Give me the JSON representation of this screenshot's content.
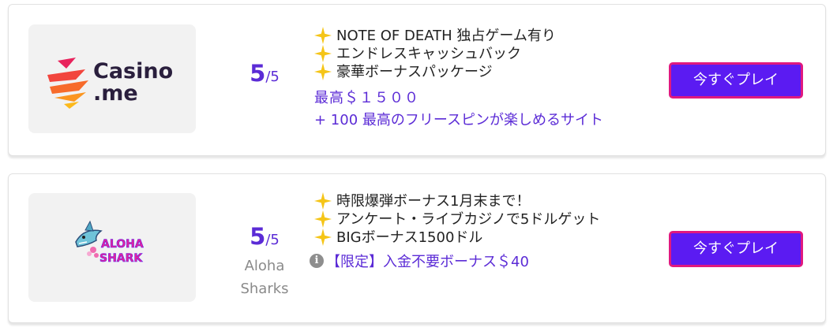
{
  "offers": [
    {
      "logo": {
        "text_line1": "Casino",
        "text_line2": ".me"
      },
      "rating": {
        "score": "5",
        "outof": "/5",
        "brand": ""
      },
      "features": [
        "NOTE OF DEATH 独占ゲーム有り",
        "エンドレスキャッシュバック",
        "豪華ボーナスパッケージ"
      ],
      "bonus_lines": [
        "最高＄１５００",
        "+ 100 最高のフリースピンが楽しめるサイト"
      ],
      "cta": "今すぐプレイ"
    },
    {
      "logo": {
        "text_line1": "ALOHA",
        "text_line2": "SHARK"
      },
      "rating": {
        "score": "5",
        "outof": "/5",
        "brand_line1": "Aloha",
        "brand_line2": "Sharks"
      },
      "features": [
        "時限爆弾ボーナス1月末まで！",
        "アンケート・ライブカジノで5ドルゲット",
        "BIGボーナス1500ドル"
      ],
      "bonus_lines": [
        "【限定】入金不要ボーナス＄40"
      ],
      "info_icon": "i",
      "cta": "今すぐプレイ"
    }
  ],
  "colors": {
    "accent": "#5b2bd6",
    "button_bg": "#5b1bf2",
    "button_border": "#e0197f",
    "star": "#f5c518"
  },
  "icons": {
    "feature_bullet": "sparkle-star-icon",
    "info": "info-icon"
  }
}
